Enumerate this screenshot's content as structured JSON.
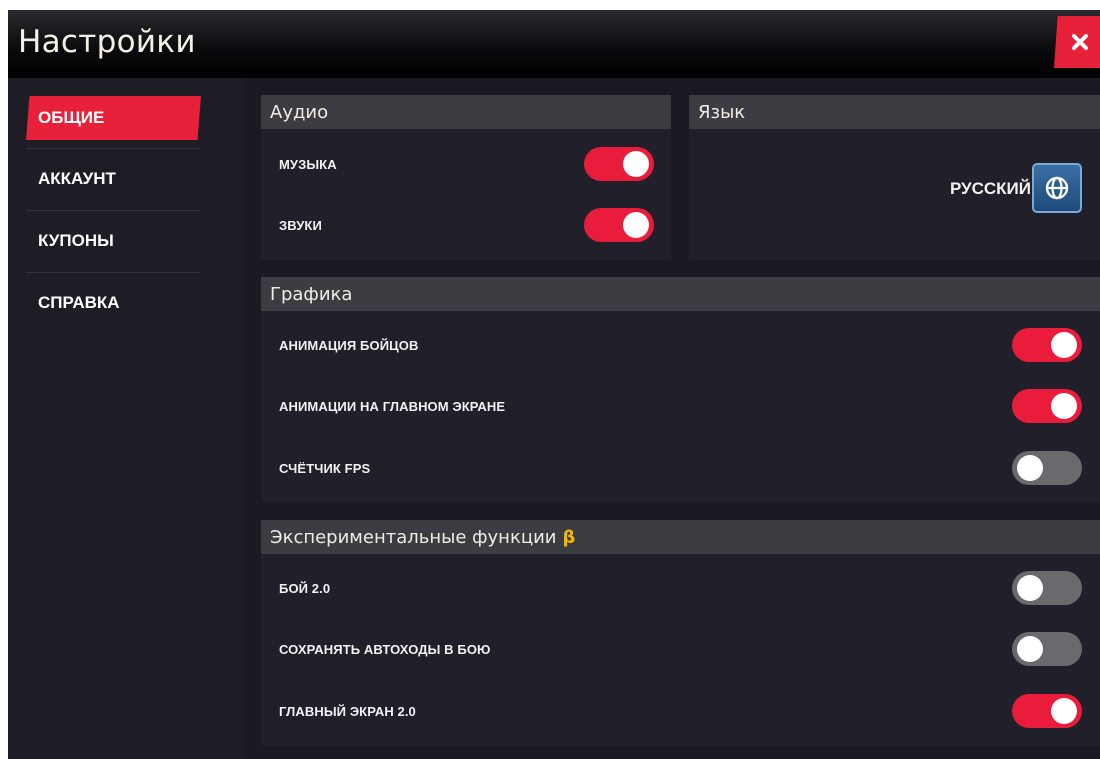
{
  "window": {
    "title": "Настройки",
    "close_icon": "close-icon"
  },
  "sidebar": {
    "items": [
      {
        "label": "ОБЩИЕ",
        "active": true
      },
      {
        "label": "АККАУНТ",
        "active": false
      },
      {
        "label": "КУПОНЫ",
        "active": false
      },
      {
        "label": "СПРАВКА",
        "active": false
      }
    ]
  },
  "audio": {
    "title": "Аудио",
    "rows": [
      {
        "label": "МУЗЫКА",
        "on": true
      },
      {
        "label": "ЗВУКИ",
        "on": true
      }
    ]
  },
  "language": {
    "title": "Язык",
    "value": "РУССКИЙ",
    "icon": "globe-icon"
  },
  "graphics": {
    "title": "Графика",
    "rows": [
      {
        "label": "АНИМАЦИЯ БОЙЦОВ",
        "on": true
      },
      {
        "label": "АНИМАЦИИ НА ГЛАВНОМ ЭКРАНЕ",
        "on": true
      },
      {
        "label": "СЧЁТЧИК FPS",
        "on": false
      }
    ]
  },
  "experimental": {
    "title": "Экспериментальные функции",
    "beta": "β",
    "rows": [
      {
        "label": "БОЙ 2.0",
        "on": false
      },
      {
        "label": "СОХРАНЯТЬ АВТОХОДЫ В БОЮ",
        "on": false
      },
      {
        "label": "ГЛАВНЫЙ ЭКРАН 2.0",
        "on": true
      }
    ]
  },
  "colors": {
    "accent": "#e8213a",
    "toggle_on": "#ea1c3c",
    "toggle_off": "#6a6a6e",
    "beta": "#f5b800"
  }
}
